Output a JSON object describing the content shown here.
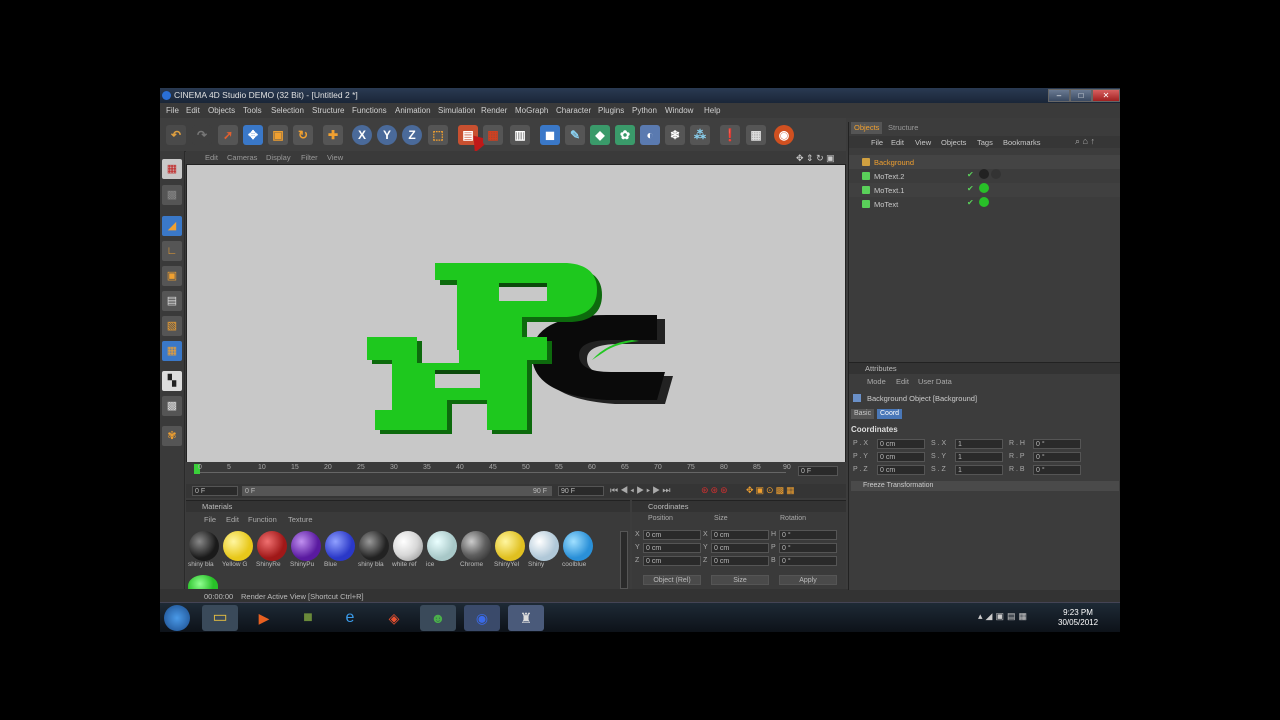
{
  "window": {
    "title": "CINEMA 4D Studio DEMO (32 Bit) - [Untitled 2 *]"
  },
  "menu": [
    "File",
    "Edit",
    "Objects",
    "Tools",
    "Selection",
    "Structure",
    "Functions",
    "Animation",
    "Simulation",
    "Render",
    "MoGraph",
    "Character",
    "Plugins",
    "Python",
    "Window",
    "Help"
  ],
  "viewport": {
    "menu": [
      "Edit",
      "Cameras",
      "Display",
      "Filter",
      "View"
    ]
  },
  "timeline": {
    "ticks": [
      "0",
      "5",
      "10",
      "15",
      "20",
      "25",
      "30",
      "35",
      "40",
      "45",
      "50",
      "55",
      "60",
      "65",
      "70",
      "75",
      "80",
      "85",
      "90"
    ],
    "frame_end_label": "0 F",
    "start": "0 F",
    "min": "0 F",
    "max": "90 F",
    "end": "90 F"
  },
  "materials": {
    "title": "Materials",
    "menu": [
      "File",
      "Edit",
      "Function",
      "Texture"
    ],
    "items": [
      {
        "label": "shiny bla",
        "color": "#1a1a1a"
      },
      {
        "label": "Yellow G",
        "color": "#e8c81a"
      },
      {
        "label": "ShinyRe",
        "color": "#a01818"
      },
      {
        "label": "ShinyPu",
        "color": "#5a1aa0"
      },
      {
        "label": "Blue",
        "color": "#2a38c8"
      },
      {
        "label": "shiny bla",
        "color": "#222222"
      },
      {
        "label": "white ref",
        "color": "#d8d8d8"
      },
      {
        "label": "ice",
        "color": "#a8c8c8"
      },
      {
        "label": "Chrome",
        "color": "#606060"
      },
      {
        "label": "ShinyYel",
        "color": "#e0c020"
      },
      {
        "label": "Shiny",
        "color": "#b0c8d8"
      },
      {
        "label": "coolblue",
        "color": "#2a90d8"
      }
    ],
    "extra_color": "#28c028"
  },
  "coordinates": {
    "title": "Coordinates",
    "headers": [
      "Position",
      "Size",
      "Rotation"
    ],
    "rows": [
      {
        "axis": "X",
        "pos": "0 cm",
        "saxis": "X",
        "size": "0 cm",
        "raxis": "H",
        "rot": "0 °"
      },
      {
        "axis": "Y",
        "pos": "0 cm",
        "saxis": "Y",
        "size": "0 cm",
        "raxis": "P",
        "rot": "0 °"
      },
      {
        "axis": "Z",
        "pos": "0 cm",
        "saxis": "Z",
        "size": "0 cm",
        "raxis": "B",
        "rot": "0 °"
      }
    ],
    "mode": "Object (Rel)",
    "size_mode": "Size",
    "apply": "Apply"
  },
  "status": {
    "time": "00:00:00",
    "text": "Render Active View [Shortcut Ctrl+R]"
  },
  "objects": {
    "tabs": [
      "Objects",
      "Structure"
    ],
    "menu": [
      "File",
      "Edit",
      "View",
      "Objects",
      "Tags",
      "Bookmarks"
    ],
    "items": [
      "Background",
      "MoText.2",
      "MoText.1",
      "MoText"
    ]
  },
  "attributes": {
    "title": "Attributes",
    "menu": [
      "Mode",
      "Edit",
      "User Data"
    ],
    "object_label": "Background Object [Background]",
    "tabs": [
      "Basic",
      "Coord"
    ],
    "section": "Coordinates",
    "rows": [
      {
        "a": "P . X",
        "av": "0 cm",
        "b": "S . X",
        "bv": "1",
        "c": "R . H",
        "cv": "0 °"
      },
      {
        "a": "P . Y",
        "av": "0 cm",
        "b": "S . Y",
        "bv": "1",
        "c": "R . P",
        "cv": "0 °"
      },
      {
        "a": "P . Z",
        "av": "0 cm",
        "b": "S . Z",
        "bv": "1",
        "c": "R . B",
        "cv": "0 °"
      }
    ],
    "freeze": "Freeze Transformation"
  },
  "clock": {
    "time": "9:23 PM",
    "date": "30/05/2012"
  },
  "colors": {
    "accent": "#f0a030",
    "green_text": "#22c722",
    "dark_text": "#111111"
  }
}
